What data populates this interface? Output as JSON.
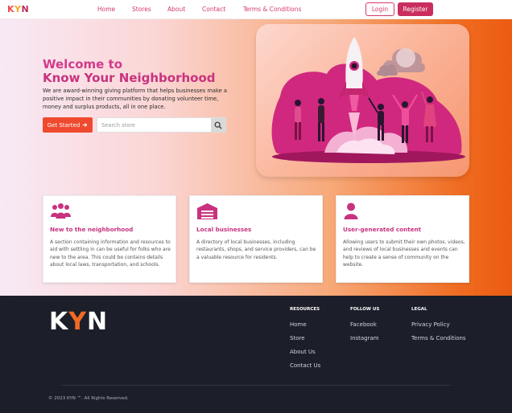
{
  "nav": {
    "logo": {
      "k": "K",
      "y": "Y",
      "n": "N"
    },
    "links": [
      "Home",
      "Stores",
      "About",
      "Contact",
      "Terms & Conditions"
    ],
    "login": "Login",
    "register": "Register"
  },
  "hero": {
    "title_line1": "Welcome to",
    "title_line2": "Know Your Neighborhood",
    "description": "We are award-winning giving platform that helps businesses make a positive impact in their communities by donating volunteer time, money and surplus products, all in one place.",
    "cta": "Get Started",
    "search_placeholder": "Search store"
  },
  "features": [
    {
      "icon": "community-icon",
      "title": "New to the neighborhood",
      "text": "A section containing information and resources to aid with settling in can be useful for folks who are new to the area. This could be contains details about local laws, transportation, and schools."
    },
    {
      "icon": "storefront-icon",
      "title": "Local businesses",
      "text": "A directory of local businesses, including restaurants, shops, and service providers, can be a valuable resource for residents."
    },
    {
      "icon": "user-icon",
      "title": "User-generated content",
      "text": "Allowing users to submit their own photos, videos, and reviews of local businesses and events can help to create a sense of community on the website."
    }
  ],
  "footer": {
    "logo": {
      "k": "K",
      "y": "Y",
      "n": "N"
    },
    "columns": [
      {
        "heading": "RESOURCES",
        "links": [
          "Home",
          "Store",
          "About Us",
          "Contact Us"
        ]
      },
      {
        "heading": "FOLLOW US",
        "links": [
          "Facebook",
          "Instagram"
        ]
      },
      {
        "heading": "LEGAL",
        "links": [
          "Privacy Policy",
          "Terms & Conditions"
        ]
      }
    ],
    "copyright": "© 2023 KYN ™. All Rights Reserved."
  },
  "colors": {
    "accent": "#c92e5e",
    "orange": "#ef4a2f",
    "footer_bg": "#1c1f29"
  }
}
